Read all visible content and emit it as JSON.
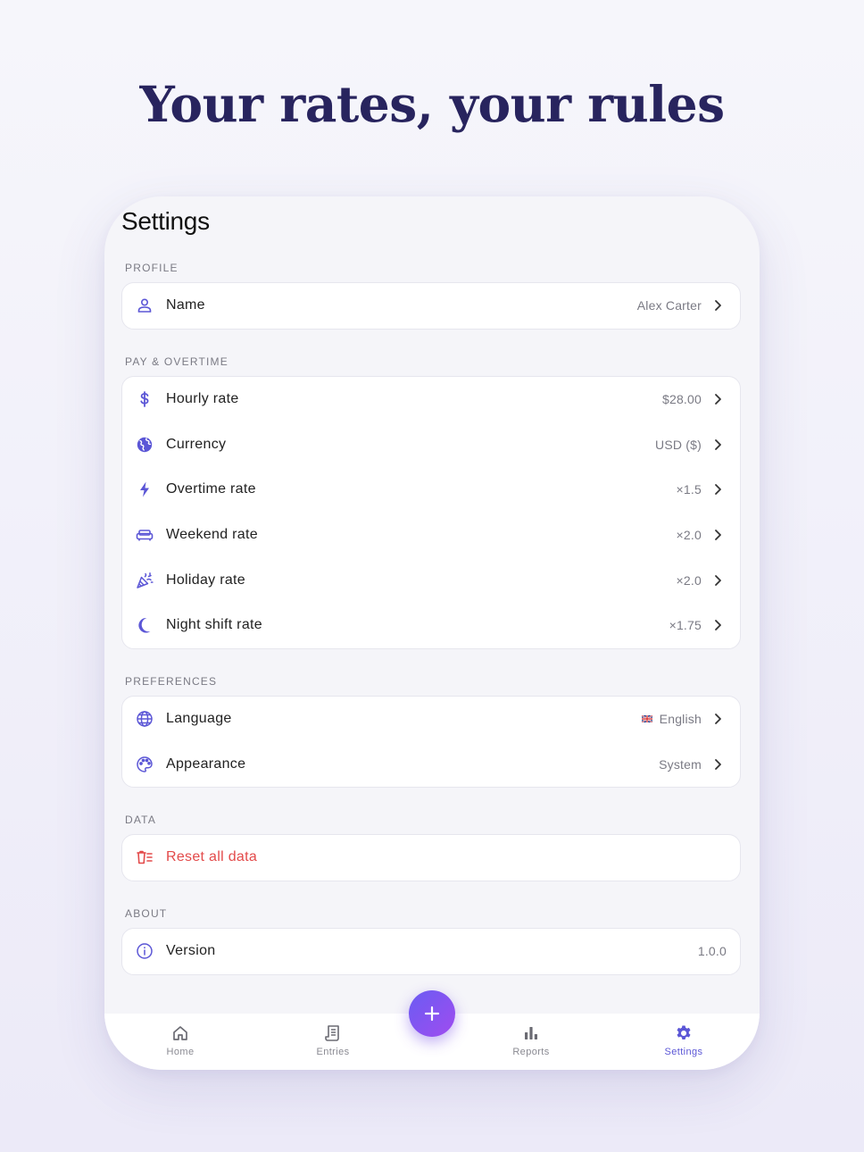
{
  "headline": "Your rates, your rules",
  "screen": {
    "title": "Settings"
  },
  "sections": {
    "profile": {
      "label": "PROFILE",
      "rows": [
        {
          "label": "Name",
          "value": "Alex Carter",
          "icon": "person-icon"
        }
      ]
    },
    "pay": {
      "label": "PAY & OVERTIME",
      "rows": [
        {
          "label": "Hourly rate",
          "value": "$28.00",
          "icon": "dollar-icon"
        },
        {
          "label": "Currency",
          "value": "USD ($)",
          "icon": "globe-americas-icon"
        },
        {
          "label": "Overtime rate",
          "value": "×1.5",
          "icon": "lightning-icon"
        },
        {
          "label": "Weekend rate",
          "value": "×2.0",
          "icon": "sofa-icon"
        },
        {
          "label": "Holiday rate",
          "value": "×2.0",
          "icon": "party-popper-icon"
        },
        {
          "label": "Night shift rate",
          "value": "×1.75",
          "icon": "moon-icon"
        }
      ]
    },
    "preferences": {
      "label": "PREFERENCES",
      "rows": [
        {
          "label": "Language",
          "value": "English",
          "flag": "uk-flag",
          "icon": "globe-icon"
        },
        {
          "label": "Appearance",
          "value": "System",
          "icon": "palette-icon"
        }
      ]
    },
    "data": {
      "label": "DATA",
      "rows": [
        {
          "label": "Reset all data",
          "icon": "trash-icon"
        }
      ]
    },
    "about": {
      "label": "ABOUT",
      "rows": [
        {
          "label": "Version",
          "value": "1.0.0",
          "icon": "info-icon"
        }
      ]
    }
  },
  "tabbar": {
    "tabs": [
      {
        "label": "Home",
        "icon": "home-icon"
      },
      {
        "label": "Entries",
        "icon": "receipt-icon"
      },
      {
        "label": "Reports",
        "icon": "bar-chart-icon"
      },
      {
        "label": "Settings",
        "icon": "gear-icon",
        "active": true
      }
    ],
    "fab_icon": "plus-icon"
  },
  "colors": {
    "accent": "#5b56d6",
    "danger": "#e34a4a",
    "headline": "#28245e",
    "fab_start": "#6a5cf2",
    "fab_end": "#a04cf0"
  }
}
